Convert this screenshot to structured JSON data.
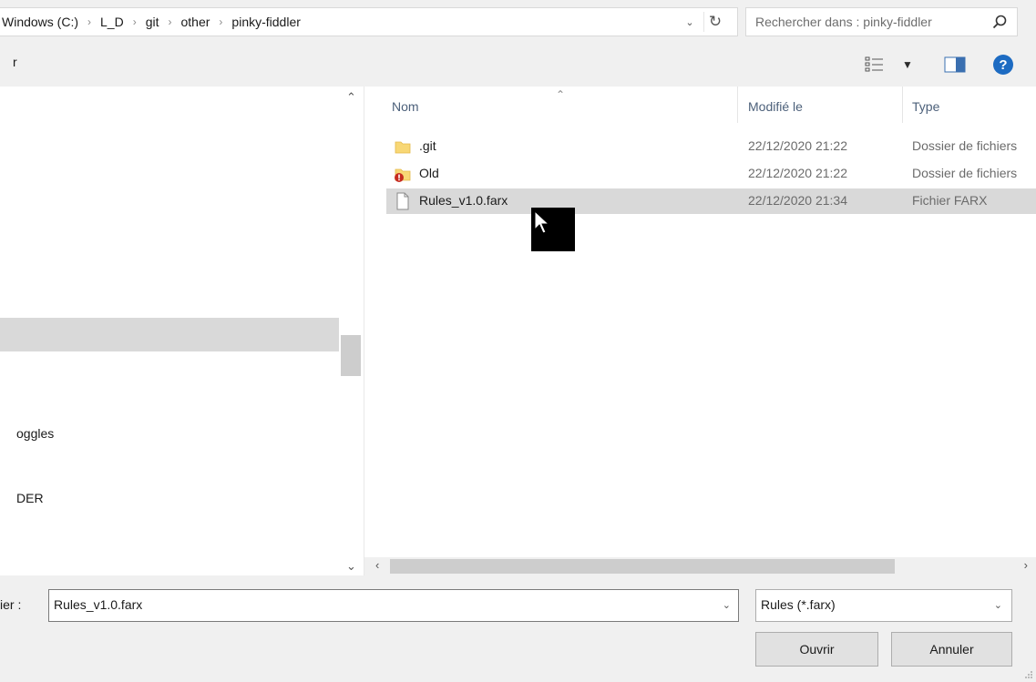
{
  "address": {
    "crumbs": [
      "Windows (C:)",
      "L_D",
      "git",
      "other",
      "pinky-fiddler"
    ],
    "separator": "›"
  },
  "search": {
    "placeholder": "Rechercher dans : pinky-fiddler"
  },
  "toolbar": {
    "left_fragment": "r"
  },
  "nav": {
    "items": [
      {
        "label": "oggles"
      },
      {
        "label": "DER"
      }
    ]
  },
  "columns": {
    "name": "Nom",
    "modified": "Modifié le",
    "type": "Type"
  },
  "files": [
    {
      "name": ".git",
      "modified": "22/12/2020 21:22",
      "type": "Dossier de fichiers",
      "icon": "folder-icon"
    },
    {
      "name": "Old",
      "modified": "22/12/2020 21:22",
      "type": "Dossier de fichiers",
      "icon": "folder-error-icon"
    },
    {
      "name": "Rules_v1.0.farx",
      "modified": "22/12/2020 21:34",
      "type": "Fichier FARX",
      "icon": "file-icon",
      "selected": true
    }
  ],
  "bottom": {
    "filename_label": "ier :",
    "filename_value": "Rules_v1.0.farx",
    "filter_value": "Rules (*.farx)",
    "open_label": "Ouvrir",
    "cancel_label": "Annuler"
  },
  "colors": {
    "selection": "#d9d9d9",
    "header_text": "#4c607a",
    "help_icon": "#1d6bc2"
  }
}
